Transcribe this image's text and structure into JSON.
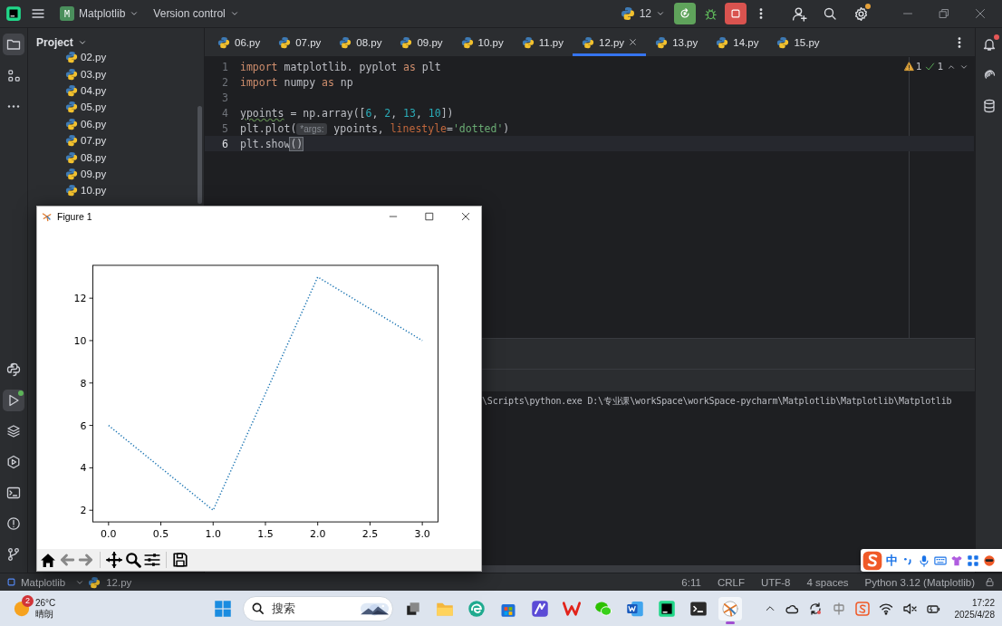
{
  "toolbar": {
    "project_badge": "M",
    "project": "Matplotlib",
    "vcs": "Version control",
    "interpreter": "12"
  },
  "project_panel": {
    "title": "Project",
    "files": [
      {
        "name": "02.py"
      },
      {
        "name": "03.py"
      },
      {
        "name": "04.py"
      },
      {
        "name": "05.py"
      },
      {
        "name": "06.py"
      },
      {
        "name": "07.py"
      },
      {
        "name": "08.py"
      },
      {
        "name": "09.py"
      },
      {
        "name": "10.py"
      }
    ]
  },
  "tabs": [
    {
      "label": "06.py",
      "selected": false
    },
    {
      "label": "07.py",
      "selected": false
    },
    {
      "label": "08.py",
      "selected": false
    },
    {
      "label": "09.py",
      "selected": false
    },
    {
      "label": "10.py",
      "selected": false
    },
    {
      "label": "11.py",
      "selected": false
    },
    {
      "label": "12.py",
      "selected": true
    },
    {
      "label": "13.py",
      "selected": false
    },
    {
      "label": "14.py",
      "selected": false
    },
    {
      "label": "15.py",
      "selected": false
    }
  ],
  "editor": {
    "warnings": "1",
    "checks": "1",
    "lines": [
      {
        "number": "1",
        "selected": false,
        "tokens": [
          {
            "kind": "keyword",
            "text": "import"
          },
          {
            "kind": "plain",
            "text": " matplotlib. pyplot "
          },
          {
            "kind": "keyword",
            "text": "as"
          },
          {
            "kind": "plain",
            "text": " plt"
          }
        ]
      },
      {
        "number": "2",
        "selected": false,
        "tokens": [
          {
            "kind": "keyword",
            "text": "import"
          },
          {
            "kind": "plain",
            "text": " numpy "
          },
          {
            "kind": "keyword",
            "text": "as"
          },
          {
            "kind": "plain",
            "text": " np"
          }
        ]
      },
      {
        "number": "3",
        "selected": false
      },
      {
        "number": "4",
        "selected": false,
        "tokens": [
          {
            "kind": "warned",
            "text": "ypoints"
          },
          {
            "kind": "plain",
            "text": " = np.array(["
          },
          {
            "kind": "number",
            "text": "6"
          },
          {
            "kind": "plain",
            "text": ", "
          },
          {
            "kind": "number",
            "text": "2"
          },
          {
            "kind": "plain",
            "text": ", "
          },
          {
            "kind": "number",
            "text": "13"
          },
          {
            "kind": "plain",
            "text": ", "
          },
          {
            "kind": "number",
            "text": "10"
          },
          {
            "kind": "plain",
            "text": "])"
          }
        ]
      },
      {
        "number": "5",
        "selected": false,
        "tokens": [
          {
            "kind": "plain",
            "text": "plt.plot("
          },
          {
            "kind": "hint",
            "text": "*args:"
          },
          {
            "kind": "plain",
            "text": " ypoints, "
          },
          {
            "kind": "param",
            "text": "linestyle"
          },
          {
            "kind": "plain",
            "text": "="
          },
          {
            "kind": "string",
            "text": "'dotted'"
          },
          {
            "kind": "plain",
            "text": ")"
          }
        ]
      },
      {
        "number": "6",
        "selected": true,
        "tokens": [
          {
            "kind": "plain",
            "text": "plt.show"
          },
          {
            "kind": "matched",
            "text": "()"
          }
        ]
      }
    ]
  },
  "console": {
    "lines": [
      "\\Scripts\\python.exe D:\\专业课\\workSpace\\workSpace-pycharm\\Matplotlib\\Matplotlib\\Matplotlib"
    ]
  },
  "figure": {
    "title": "Figure 1",
    "chart_data": {
      "type": "line",
      "x": [
        0,
        1,
        2,
        3
      ],
      "series": [
        {
          "color": "#1f77b4",
          "line_style": "dotted",
          "values": [
            6,
            2,
            13,
            10
          ]
        }
      ],
      "xlim": [
        -0.15,
        3.15
      ],
      "ylim": [
        1.45,
        13.55
      ],
      "xticks": [
        {
          "value": 0,
          "label": "0.0"
        },
        {
          "value": 0.5,
          "label": "0.5"
        },
        {
          "value": 1,
          "label": "1.0"
        },
        {
          "value": 1.5,
          "label": "1.5"
        },
        {
          "value": 2,
          "label": "2.0"
        },
        {
          "value": 2.5,
          "label": "2.5"
        },
        {
          "value": 3,
          "label": "3.0"
        }
      ],
      "yticks": [
        2,
        4,
        6,
        8,
        10,
        12
      ]
    }
  },
  "status_bar": {
    "breadcrumbs": [
      "Matplotlib",
      "12.py"
    ],
    "items": [
      "6:11",
      "CRLF",
      "UTF-8",
      "4 spaces",
      "Python 3.12 (Matplotlib)"
    ]
  },
  "ime": {
    "mode": "中"
  },
  "taskbar": {
    "weather": {
      "badge": "2",
      "temperature": "26°C",
      "condition": "晴朗"
    },
    "search": {
      "placeholder": "搜索"
    },
    "time": "17:22",
    "date": "2025/4/28"
  }
}
